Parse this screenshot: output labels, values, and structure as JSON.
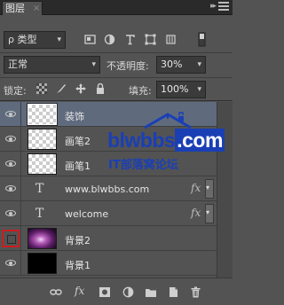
{
  "panel": {
    "tab_label": "图层",
    "tab_close": "×"
  },
  "filter": {
    "kind_label": "类型",
    "kind_prefix": "ρ"
  },
  "blend": {
    "mode": "正常",
    "opacity_label": "不透明度:",
    "opacity_value": "30%"
  },
  "lock": {
    "label": "锁定:",
    "fill_label": "填充:",
    "fill_value": "100%"
  },
  "layers": [
    {
      "name": "装饰",
      "type": "raster",
      "visible": true,
      "selected": true
    },
    {
      "name": "画笔2",
      "type": "raster",
      "visible": true,
      "selected": false
    },
    {
      "name": "画笔1",
      "type": "raster",
      "visible": true,
      "selected": false
    },
    {
      "name": "www.blwbbs.com",
      "type": "text",
      "visible": true,
      "selected": false,
      "effects": true
    },
    {
      "name": "welcome",
      "type": "text",
      "visible": true,
      "selected": false,
      "effects": true
    },
    {
      "name": "背景2",
      "type": "raster",
      "visible": false,
      "selected": false
    },
    {
      "name": "背景1",
      "type": "raster",
      "visible": true,
      "selected": false
    }
  ],
  "text_glyph": "T",
  "fx_label": "fx",
  "watermark": {
    "main": "blwbbs",
    "com": ".com",
    "sub": "IT部落窝论坛"
  },
  "colors": {
    "panel": "#535353",
    "selected_row": "#5f6b7d",
    "highlight_box": "#c81e1e",
    "watermark_blue": "#1a3fb5"
  }
}
